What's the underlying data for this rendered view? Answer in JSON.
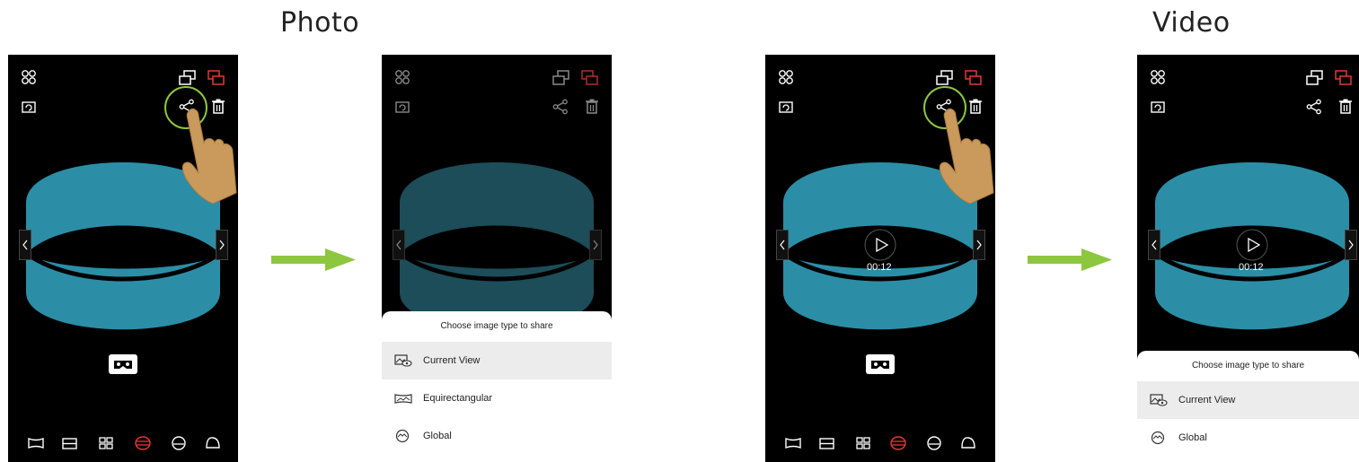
{
  "sections": {
    "photo_title": "Photo",
    "video_title": "Video"
  },
  "sheet_photo": {
    "title": "Choose image type to share",
    "items": [
      "Current View",
      "Equirectangular",
      "Global"
    ]
  },
  "sheet_video": {
    "title": "Choose image type to share",
    "items": [
      "Current View",
      "Global"
    ]
  },
  "video": {
    "time": "00:12"
  },
  "colors": {
    "accent_green": "#8dc63f",
    "cylinder": "#2b8ea6",
    "cylinder_dim": "#1c4d59",
    "red_icon": "#e53935",
    "phone_bg": "#000000"
  },
  "icons": {
    "top_left": "grid-circles-icon",
    "top_right_1": "screen-mirror-icon",
    "top_right_2": "red-screen-icon",
    "rotate": "rotate-icon",
    "share": "share-icon",
    "delete": "trash-icon",
    "vr": "vr-glasses-icon",
    "play": "play-icon"
  }
}
